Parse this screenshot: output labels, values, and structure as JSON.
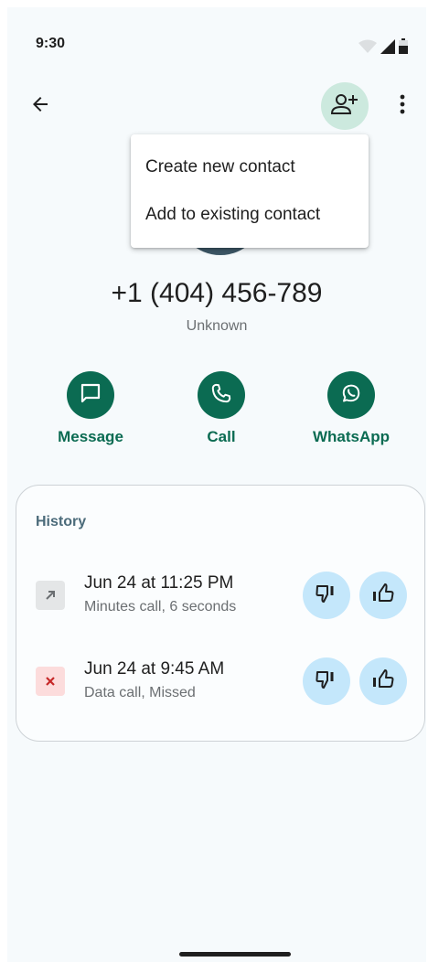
{
  "status_bar": {
    "time": "9:30",
    "icons": [
      "wifi-icon",
      "cell-signal-icon",
      "battery-icon"
    ]
  },
  "top_bar": {
    "back_icon": "arrow-left-icon",
    "add_contact_icon": "person-add-icon",
    "more_icon": "more-vert-icon"
  },
  "menu": {
    "items": [
      {
        "label": "Create new contact"
      },
      {
        "label": "Add to existing contact"
      }
    ]
  },
  "contact": {
    "number": "+1 (404) 456-789",
    "label": "Unknown"
  },
  "actions": [
    {
      "label": "Message",
      "icon": "message-icon"
    },
    {
      "label": "Call",
      "icon": "phone-icon"
    },
    {
      "label": "WhatsApp",
      "icon": "whatsapp-icon"
    }
  ],
  "history": {
    "title": "History",
    "entries": [
      {
        "date": "Jun 24 at 11:25 PM",
        "detail": "Minutes call, 6 seconds",
        "type": "outgoing"
      },
      {
        "date": "Jun 24 at 9:45 AM",
        "detail": "Data call, Missed",
        "type": "missed"
      }
    ]
  },
  "colors": {
    "accent": "#0b6b52",
    "add_contact_bg": "#cce9de",
    "rate_bg": "#c4e7fb",
    "missed": "#c62828",
    "screen_bg": "#f6fafc"
  }
}
